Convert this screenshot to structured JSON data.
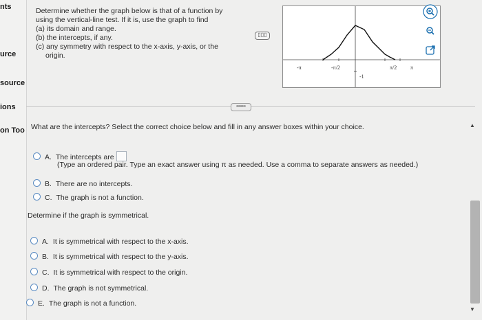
{
  "sidebar": {
    "items": [
      "nts",
      "urce",
      "source",
      "ions",
      "on Too"
    ]
  },
  "question": {
    "intro": "Determine whether the graph below is that of a function by",
    "intro2": "using the vertical-line test. If it is, use the graph to find",
    "a": "(a) its domain and range.",
    "b": "(b) the intercepts, if any.",
    "c": "(c) any symmetry with respect to the x-axis, y-axis, or the",
    "c2": "origin."
  },
  "graph": {
    "labels": {
      "neg_pi": "-π",
      "neg_pi_half": "-π/2",
      "pi_half": "π/2",
      "pi": "π",
      "neg_one": "-1"
    }
  },
  "tools": {
    "zoom_in": "zoom-in-icon",
    "zoom_out": "zoom-out-icon",
    "popout": "popout-icon"
  },
  "collapse_label": "•••••",
  "prompt": "What are the intercepts? Select the correct choice below and fill in any answer boxes within your choice.",
  "intercepts": {
    "a_letter": "A.",
    "a_text": "The intercepts are",
    "note": "(Type an ordered pair. Type an exact answer using π as needed. Use a comma to separate answers as needed.)",
    "b_letter": "B.",
    "b_text": "There are no intercepts.",
    "c_letter": "C.",
    "c_text": "The graph is not a function."
  },
  "symmetry": {
    "heading": "Determine if the graph is symmetrical.",
    "a_letter": "A.",
    "a_text": "It is symmetrical with respect to the x-axis.",
    "b_letter": "B.",
    "b_text": "It is symmetrical with respect to the y-axis.",
    "c_letter": "C.",
    "c_text": "It is symmetrical with respect to the origin.",
    "d_letter": "D.",
    "d_text": "The graph is not symmetrical.",
    "e_letter": "E.",
    "e_text": "The graph is not a function."
  },
  "scroll": {
    "up": "▲",
    "down": "▼"
  },
  "colors": {
    "accent": "#1a6fb0",
    "radio_border": "#5b8cc2"
  }
}
